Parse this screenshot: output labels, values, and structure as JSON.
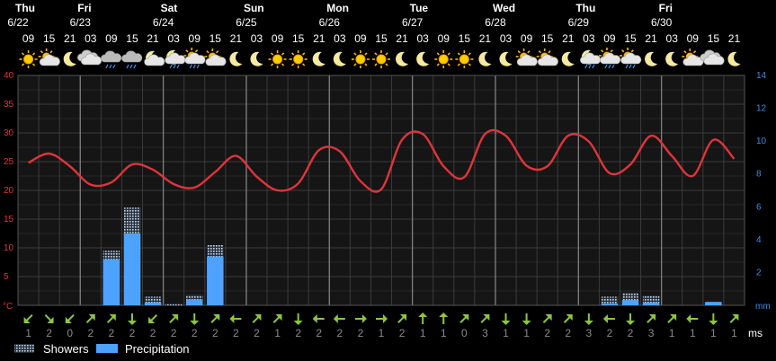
{
  "chart_data": {
    "type": "bar",
    "title": "",
    "days": [
      {
        "day": "Thu",
        "date": "6/22"
      },
      {
        "day": "Fri",
        "date": "6/23"
      },
      {
        "day": "Sat",
        "date": "6/24"
      },
      {
        "day": "Sun",
        "date": "6/25"
      },
      {
        "day": "Mon",
        "date": "6/26"
      },
      {
        "day": "Tue",
        "date": "6/27"
      },
      {
        "day": "Wed",
        "date": "6/28"
      },
      {
        "day": "Thu",
        "date": "6/29"
      },
      {
        "day": "Fri",
        "date": "6/30"
      }
    ],
    "hours": [
      "09",
      "15",
      "21",
      "03",
      "09",
      "15",
      "21",
      "03",
      "09",
      "15",
      "21",
      "03",
      "09",
      "15",
      "21",
      "03",
      "09",
      "15",
      "21",
      "03",
      "09",
      "15",
      "21",
      "03",
      "09",
      "15",
      "21",
      "03",
      "09",
      "15",
      "21",
      "03",
      "09",
      "15",
      "21"
    ],
    "icons": [
      "sun",
      "sun-cloud",
      "moon",
      "cloud",
      "rain-cloud",
      "rain-cloud",
      "moon-cloud",
      "moon-rain",
      "sun-rain",
      "sun-cloud",
      "moon",
      "moon",
      "sun",
      "sun",
      "moon",
      "moon",
      "sun",
      "sun",
      "moon",
      "moon",
      "sun",
      "sun",
      "moon",
      "moon",
      "sun-cloud",
      "sun-cloud",
      "moon",
      "moon-rain",
      "sun-rain",
      "sun-rain",
      "moon",
      "moon",
      "sun-cloud",
      "cloud",
      "moon"
    ],
    "temperature_series": {
      "name": "",
      "unit": "°C",
      "values": [
        24.8,
        26.4,
        24.2,
        21.0,
        21.4,
        24.5,
        23.6,
        21.1,
        20.5,
        23.2,
        26.0,
        22.4,
        20.0,
        21.2,
        27.0,
        26.8,
        21.6,
        20.2,
        28.8,
        29.8,
        24.2,
        22.3,
        29.8,
        29.5,
        24.3,
        24.2,
        29.5,
        28.5,
        23.0,
        24.5,
        29.5,
        26.0,
        22.5,
        28.8,
        25.5
      ]
    },
    "series": [
      {
        "name": "Showers",
        "values": [
          0,
          0,
          0,
          0,
          9.5,
          17.0,
          1.5,
          0.3,
          1.8,
          10.5,
          0,
          0,
          0,
          0,
          0,
          0,
          0,
          0,
          0,
          0,
          0,
          0,
          0,
          0,
          0,
          0,
          0,
          0,
          1.5,
          2.2,
          1.7,
          0,
          0,
          0.3,
          0
        ]
      },
      {
        "name": "Precipitation",
        "values": [
          0,
          0,
          0,
          0,
          8.0,
          12.5,
          0.5,
          0,
          1.0,
          8.5,
          0,
          0,
          0,
          0,
          0,
          0,
          0,
          0,
          0,
          0,
          0,
          0,
          0,
          0,
          0,
          0,
          0,
          0,
          0.3,
          0.9,
          0.5,
          0,
          0,
          0.6,
          0
        ]
      }
    ],
    "y_left": {
      "label": "°C",
      "range": [
        0,
        40
      ],
      "ticks": [
        "40",
        "35",
        "30",
        "25",
        "20",
        "15",
        "10",
        "5"
      ]
    },
    "y_right": {
      "label": "mm",
      "range": [
        0,
        14
      ],
      "ticks": [
        "14",
        "12",
        "10",
        "8",
        "6",
        "4",
        "2"
      ]
    },
    "wind": {
      "unit": "ms",
      "dir": [
        135,
        45,
        135,
        315,
        315,
        90,
        135,
        315,
        90,
        315,
        180,
        315,
        315,
        90,
        180,
        180,
        0,
        0,
        315,
        270,
        270,
        315,
        315,
        90,
        90,
        315,
        315,
        90,
        180,
        90,
        315,
        315,
        180,
        90,
        315
      ],
      "speed": [
        "1",
        "2",
        "0",
        "2",
        "2",
        "2",
        "2",
        "2",
        "2",
        "2",
        "2",
        "2",
        "1",
        "2",
        "2",
        "2",
        "2",
        "1",
        "2",
        "1",
        "1",
        "0",
        "3",
        "1",
        "1",
        "2",
        "2",
        "3",
        "2",
        "2",
        "3",
        "1",
        "1",
        "1",
        "1"
      ]
    },
    "legend": {
      "position": "bottom-left",
      "items": [
        "Showers",
        "Precipitation"
      ]
    },
    "colors": {
      "temperature": "#e0343a",
      "precipitation": "#4da2ff",
      "showers": "#c4d8ee",
      "wind": "#8cc63f",
      "grid": "#3c3c3c",
      "day_separator": "#7a7a7a"
    }
  }
}
